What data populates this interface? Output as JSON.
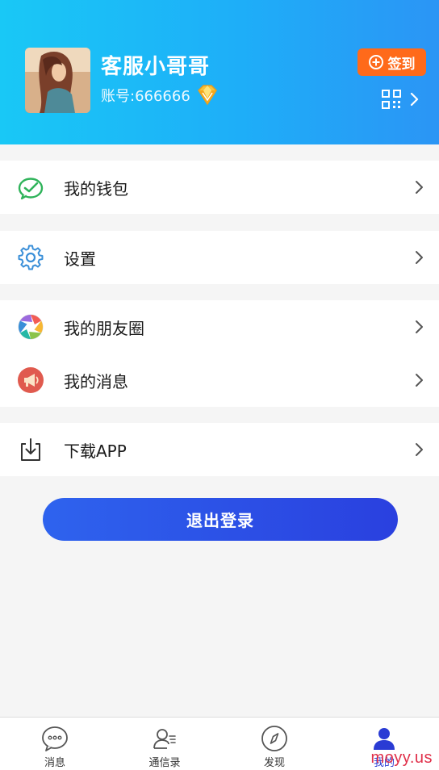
{
  "profile": {
    "name": "客服小哥哥",
    "account": "账号:666666",
    "avatar_icon": "avatar-photo",
    "badge_icon": "diamond-icon"
  },
  "header": {
    "checkin_label": "签到",
    "qr_icon": "qr-code-icon"
  },
  "menu": {
    "sections": [
      {
        "items": [
          {
            "label": "我的钱包",
            "icon": "wallet-icon"
          }
        ]
      },
      {
        "items": [
          {
            "label": "设置",
            "icon": "settings-gear-icon"
          }
        ]
      },
      {
        "items": [
          {
            "label": "我的朋友圈",
            "icon": "moments-icon"
          },
          {
            "label": "我的消息",
            "icon": "megaphone-icon"
          }
        ]
      },
      {
        "items": [
          {
            "label": "下载APP",
            "icon": "download-icon"
          }
        ]
      }
    ]
  },
  "logout_label": "退出登录",
  "tabbar": {
    "tabs": [
      {
        "label": "消息",
        "icon": "chat-bubble-icon"
      },
      {
        "label": "通信录",
        "icon": "contacts-icon"
      },
      {
        "label": "发现",
        "icon": "compass-icon"
      },
      {
        "label": "我的",
        "icon": "person-icon"
      }
    ],
    "active_index": 3
  },
  "watermark": "moyy.us",
  "colors": {
    "header_gradient_start": "#19c8f6",
    "header_gradient_end": "#2b95f5",
    "checkin_bg": "#ff6a1a",
    "logout_gradient_start": "#2e63ee",
    "logout_gradient_end": "#2a40df",
    "active_tab": "#2a3bd4",
    "watermark": "#e0304a"
  }
}
